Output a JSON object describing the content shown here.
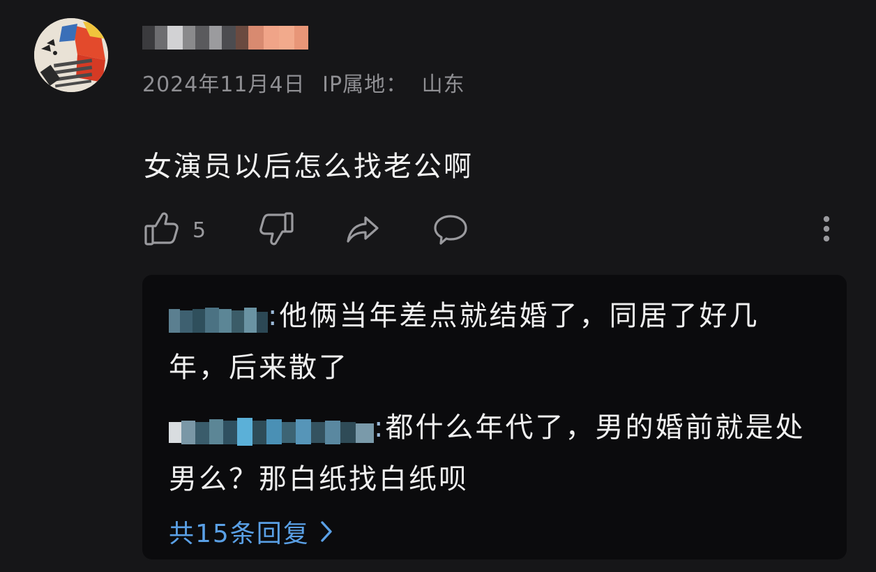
{
  "comment": {
    "date": "2024年11月4日",
    "ip_label": "IP属地：",
    "ip_location": "山东",
    "text": "女演员以后怎么找老公啊",
    "like_count": "5"
  },
  "replies": [
    {
      "text": "他俩当年差点就结婚了，同居了好几年，后来散了"
    },
    {
      "text": "都什么年代了，男的婚前就是处男么？那白纸找白纸呗"
    }
  ],
  "more_replies": {
    "label": "共15条回复"
  },
  "colors": {
    "background": "#161618",
    "reply_panel": "#0b0b0d",
    "link": "#5aa0e6",
    "meta": "#8f8f93"
  },
  "icons": {
    "like": "thumbs-up-icon",
    "dislike": "thumbs-down-icon",
    "share": "share-icon",
    "comment": "comment-bubble-icon",
    "more": "more-vertical-icon",
    "chevron": "chevron-right-icon"
  }
}
